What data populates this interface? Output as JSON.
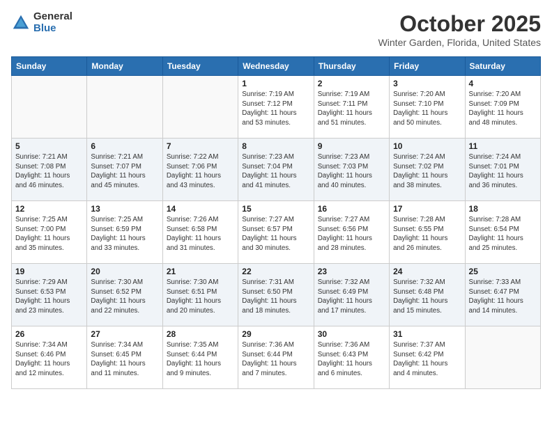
{
  "logo": {
    "general": "General",
    "blue": "Blue"
  },
  "title": "October 2025",
  "location": "Winter Garden, Florida, United States",
  "days_of_week": [
    "Sunday",
    "Monday",
    "Tuesday",
    "Wednesday",
    "Thursday",
    "Friday",
    "Saturday"
  ],
  "weeks": [
    [
      {
        "day": "",
        "info": ""
      },
      {
        "day": "",
        "info": ""
      },
      {
        "day": "",
        "info": ""
      },
      {
        "day": "1",
        "info": "Sunrise: 7:19 AM\nSunset: 7:12 PM\nDaylight: 11 hours\nand 53 minutes."
      },
      {
        "day": "2",
        "info": "Sunrise: 7:19 AM\nSunset: 7:11 PM\nDaylight: 11 hours\nand 51 minutes."
      },
      {
        "day": "3",
        "info": "Sunrise: 7:20 AM\nSunset: 7:10 PM\nDaylight: 11 hours\nand 50 minutes."
      },
      {
        "day": "4",
        "info": "Sunrise: 7:20 AM\nSunset: 7:09 PM\nDaylight: 11 hours\nand 48 minutes."
      }
    ],
    [
      {
        "day": "5",
        "info": "Sunrise: 7:21 AM\nSunset: 7:08 PM\nDaylight: 11 hours\nand 46 minutes."
      },
      {
        "day": "6",
        "info": "Sunrise: 7:21 AM\nSunset: 7:07 PM\nDaylight: 11 hours\nand 45 minutes."
      },
      {
        "day": "7",
        "info": "Sunrise: 7:22 AM\nSunset: 7:06 PM\nDaylight: 11 hours\nand 43 minutes."
      },
      {
        "day": "8",
        "info": "Sunrise: 7:23 AM\nSunset: 7:04 PM\nDaylight: 11 hours\nand 41 minutes."
      },
      {
        "day": "9",
        "info": "Sunrise: 7:23 AM\nSunset: 7:03 PM\nDaylight: 11 hours\nand 40 minutes."
      },
      {
        "day": "10",
        "info": "Sunrise: 7:24 AM\nSunset: 7:02 PM\nDaylight: 11 hours\nand 38 minutes."
      },
      {
        "day": "11",
        "info": "Sunrise: 7:24 AM\nSunset: 7:01 PM\nDaylight: 11 hours\nand 36 minutes."
      }
    ],
    [
      {
        "day": "12",
        "info": "Sunrise: 7:25 AM\nSunset: 7:00 PM\nDaylight: 11 hours\nand 35 minutes."
      },
      {
        "day": "13",
        "info": "Sunrise: 7:25 AM\nSunset: 6:59 PM\nDaylight: 11 hours\nand 33 minutes."
      },
      {
        "day": "14",
        "info": "Sunrise: 7:26 AM\nSunset: 6:58 PM\nDaylight: 11 hours\nand 31 minutes."
      },
      {
        "day": "15",
        "info": "Sunrise: 7:27 AM\nSunset: 6:57 PM\nDaylight: 11 hours\nand 30 minutes."
      },
      {
        "day": "16",
        "info": "Sunrise: 7:27 AM\nSunset: 6:56 PM\nDaylight: 11 hours\nand 28 minutes."
      },
      {
        "day": "17",
        "info": "Sunrise: 7:28 AM\nSunset: 6:55 PM\nDaylight: 11 hours\nand 26 minutes."
      },
      {
        "day": "18",
        "info": "Sunrise: 7:28 AM\nSunset: 6:54 PM\nDaylight: 11 hours\nand 25 minutes."
      }
    ],
    [
      {
        "day": "19",
        "info": "Sunrise: 7:29 AM\nSunset: 6:53 PM\nDaylight: 11 hours\nand 23 minutes."
      },
      {
        "day": "20",
        "info": "Sunrise: 7:30 AM\nSunset: 6:52 PM\nDaylight: 11 hours\nand 22 minutes."
      },
      {
        "day": "21",
        "info": "Sunrise: 7:30 AM\nSunset: 6:51 PM\nDaylight: 11 hours\nand 20 minutes."
      },
      {
        "day": "22",
        "info": "Sunrise: 7:31 AM\nSunset: 6:50 PM\nDaylight: 11 hours\nand 18 minutes."
      },
      {
        "day": "23",
        "info": "Sunrise: 7:32 AM\nSunset: 6:49 PM\nDaylight: 11 hours\nand 17 minutes."
      },
      {
        "day": "24",
        "info": "Sunrise: 7:32 AM\nSunset: 6:48 PM\nDaylight: 11 hours\nand 15 minutes."
      },
      {
        "day": "25",
        "info": "Sunrise: 7:33 AM\nSunset: 6:47 PM\nDaylight: 11 hours\nand 14 minutes."
      }
    ],
    [
      {
        "day": "26",
        "info": "Sunrise: 7:34 AM\nSunset: 6:46 PM\nDaylight: 11 hours\nand 12 minutes."
      },
      {
        "day": "27",
        "info": "Sunrise: 7:34 AM\nSunset: 6:45 PM\nDaylight: 11 hours\nand 11 minutes."
      },
      {
        "day": "28",
        "info": "Sunrise: 7:35 AM\nSunset: 6:44 PM\nDaylight: 11 hours\nand 9 minutes."
      },
      {
        "day": "29",
        "info": "Sunrise: 7:36 AM\nSunset: 6:44 PM\nDaylight: 11 hours\nand 7 minutes."
      },
      {
        "day": "30",
        "info": "Sunrise: 7:36 AM\nSunset: 6:43 PM\nDaylight: 11 hours\nand 6 minutes."
      },
      {
        "day": "31",
        "info": "Sunrise: 7:37 AM\nSunset: 6:42 PM\nDaylight: 11 hours\nand 4 minutes."
      },
      {
        "day": "",
        "info": ""
      }
    ]
  ]
}
